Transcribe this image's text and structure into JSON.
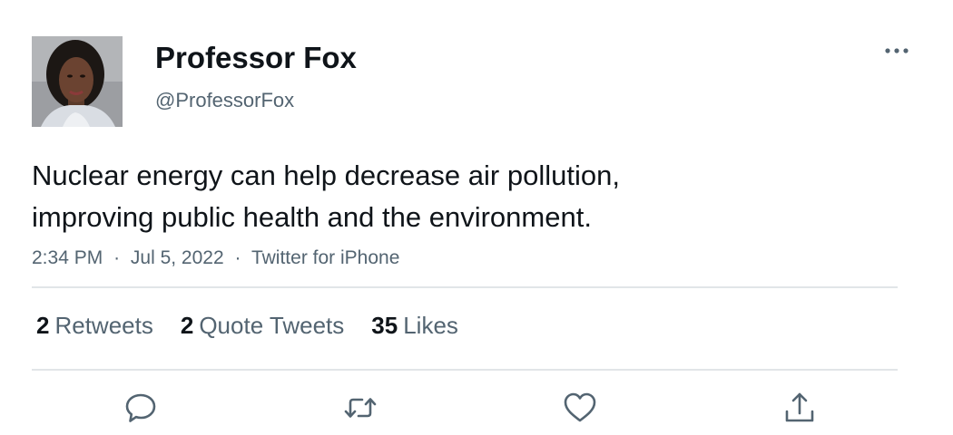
{
  "author": {
    "display_name": "Professor Fox",
    "handle": "@ProfessorFox"
  },
  "tweet": {
    "text": "Nuclear energy can help decrease air pollution,\nimproving public health and the environment.",
    "time": "2:34 PM",
    "date": "Jul 5, 2022",
    "source": "Twitter for iPhone",
    "separator": "·"
  },
  "stats": {
    "retweets": {
      "count": "2",
      "label": "Retweets"
    },
    "quote_tweets": {
      "count": "2",
      "label": "Quote Tweets"
    },
    "likes": {
      "count": "35",
      "label": "Likes"
    }
  },
  "icons": {
    "more": "more-horizontal-icon",
    "reply": "reply-icon",
    "retweet": "retweet-icon",
    "like": "heart-icon",
    "share": "share-icon"
  },
  "colors": {
    "text_primary": "#0f1419",
    "text_secondary": "#536471",
    "divider": "#e1e5e8",
    "icon": "#536471"
  }
}
